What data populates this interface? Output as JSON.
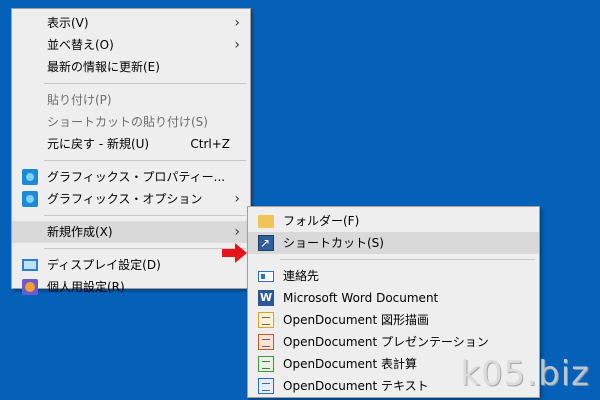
{
  "context_menu": {
    "items": [
      {
        "label": "表示(V)"
      },
      {
        "label": "並べ替え(O)"
      },
      {
        "label": "最新の情報に更新(E)"
      },
      {
        "label": "貼り付け(P)"
      },
      {
        "label": "ショートカットの貼り付け(S)"
      },
      {
        "label": "元に戻す - 新規(U)",
        "shortcut": "Ctrl+Z"
      },
      {
        "label": "グラフィックス・プロパティー..."
      },
      {
        "label": "グラフィックス・オプション"
      },
      {
        "label": "新規作成(X)"
      },
      {
        "label": "ディスプレイ設定(D)"
      },
      {
        "label": "個人用設定(R)"
      }
    ]
  },
  "submenu": {
    "items": [
      {
        "label": "フォルダー(F)"
      },
      {
        "label": "ショートカット(S)"
      },
      {
        "label": "連絡先"
      },
      {
        "label": "Microsoft Word Document"
      },
      {
        "label": "OpenDocument 図形描画"
      },
      {
        "label": "OpenDocument プレゼンテーション"
      },
      {
        "label": "OpenDocument 表計算"
      },
      {
        "label": "OpenDocument テキスト"
      }
    ]
  },
  "watermark": "k05.biz",
  "colors": {
    "desktop": "#0560b8",
    "menu_background": "#eeeeee",
    "highlight": "#d9d9d9",
    "pointer_arrow": "#e8141a"
  }
}
